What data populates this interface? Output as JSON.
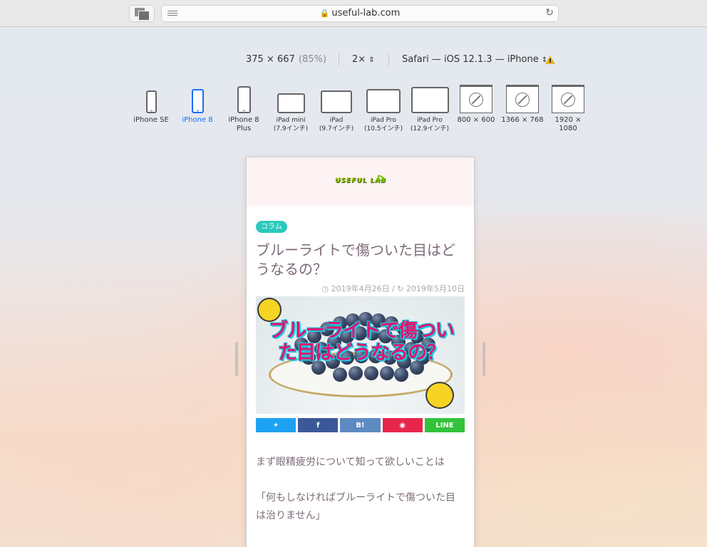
{
  "browser": {
    "url": "useful-lab.com"
  },
  "responsive_mode": {
    "dimensions": "375 × 667",
    "zoom": "(85%)",
    "pixel_ratio": "2×",
    "user_agent": "Safari — iOS 12.1.3 — iPhone",
    "devices": [
      {
        "label": "iPhone SE",
        "active": false
      },
      {
        "label": "iPhone 8",
        "active": true
      },
      {
        "label": "iPhone 8\nPlus",
        "active": false
      },
      {
        "label": "iPad mini\n(7.9インチ)",
        "active": false
      },
      {
        "label": "iPad\n(9.7インチ)",
        "active": false
      },
      {
        "label": "iPad Pro\n(10.5インチ)",
        "active": false
      },
      {
        "label": "iPad Pro\n(12.9インチ)",
        "active": false
      },
      {
        "label": "800 × 600",
        "active": false
      },
      {
        "label": "1366 × 768",
        "active": false
      },
      {
        "label": "1920 × 1080",
        "active": false
      }
    ]
  },
  "page": {
    "logo_text": "USEFUL LAB",
    "category": "コラム",
    "title": "ブルーライトで傷ついた目はどうなるの？",
    "published": "2019年4月26日",
    "updated": "2019年5月10日",
    "eyecatch_text": "ブルーライトで傷ついた目はどうなるの？",
    "share_buttons": [
      {
        "label": "",
        "icon": "twitter-icon",
        "color": "#1da1f2"
      },
      {
        "label": "f",
        "icon": "facebook-icon",
        "color": "#3b5998"
      },
      {
        "label": "B!",
        "icon": "hatena-icon",
        "color": "#5d8ac1"
      },
      {
        "label": "",
        "icon": "pocket-icon",
        "color": "#e8254b"
      },
      {
        "label": "LINE",
        "icon": "line-icon",
        "color": "#33c33a"
      }
    ],
    "paragraph1": "まず眼精疲労について知って欲しいことは",
    "paragraph2": "「何もしなければブルーライトで傷ついた目は治りません」"
  }
}
